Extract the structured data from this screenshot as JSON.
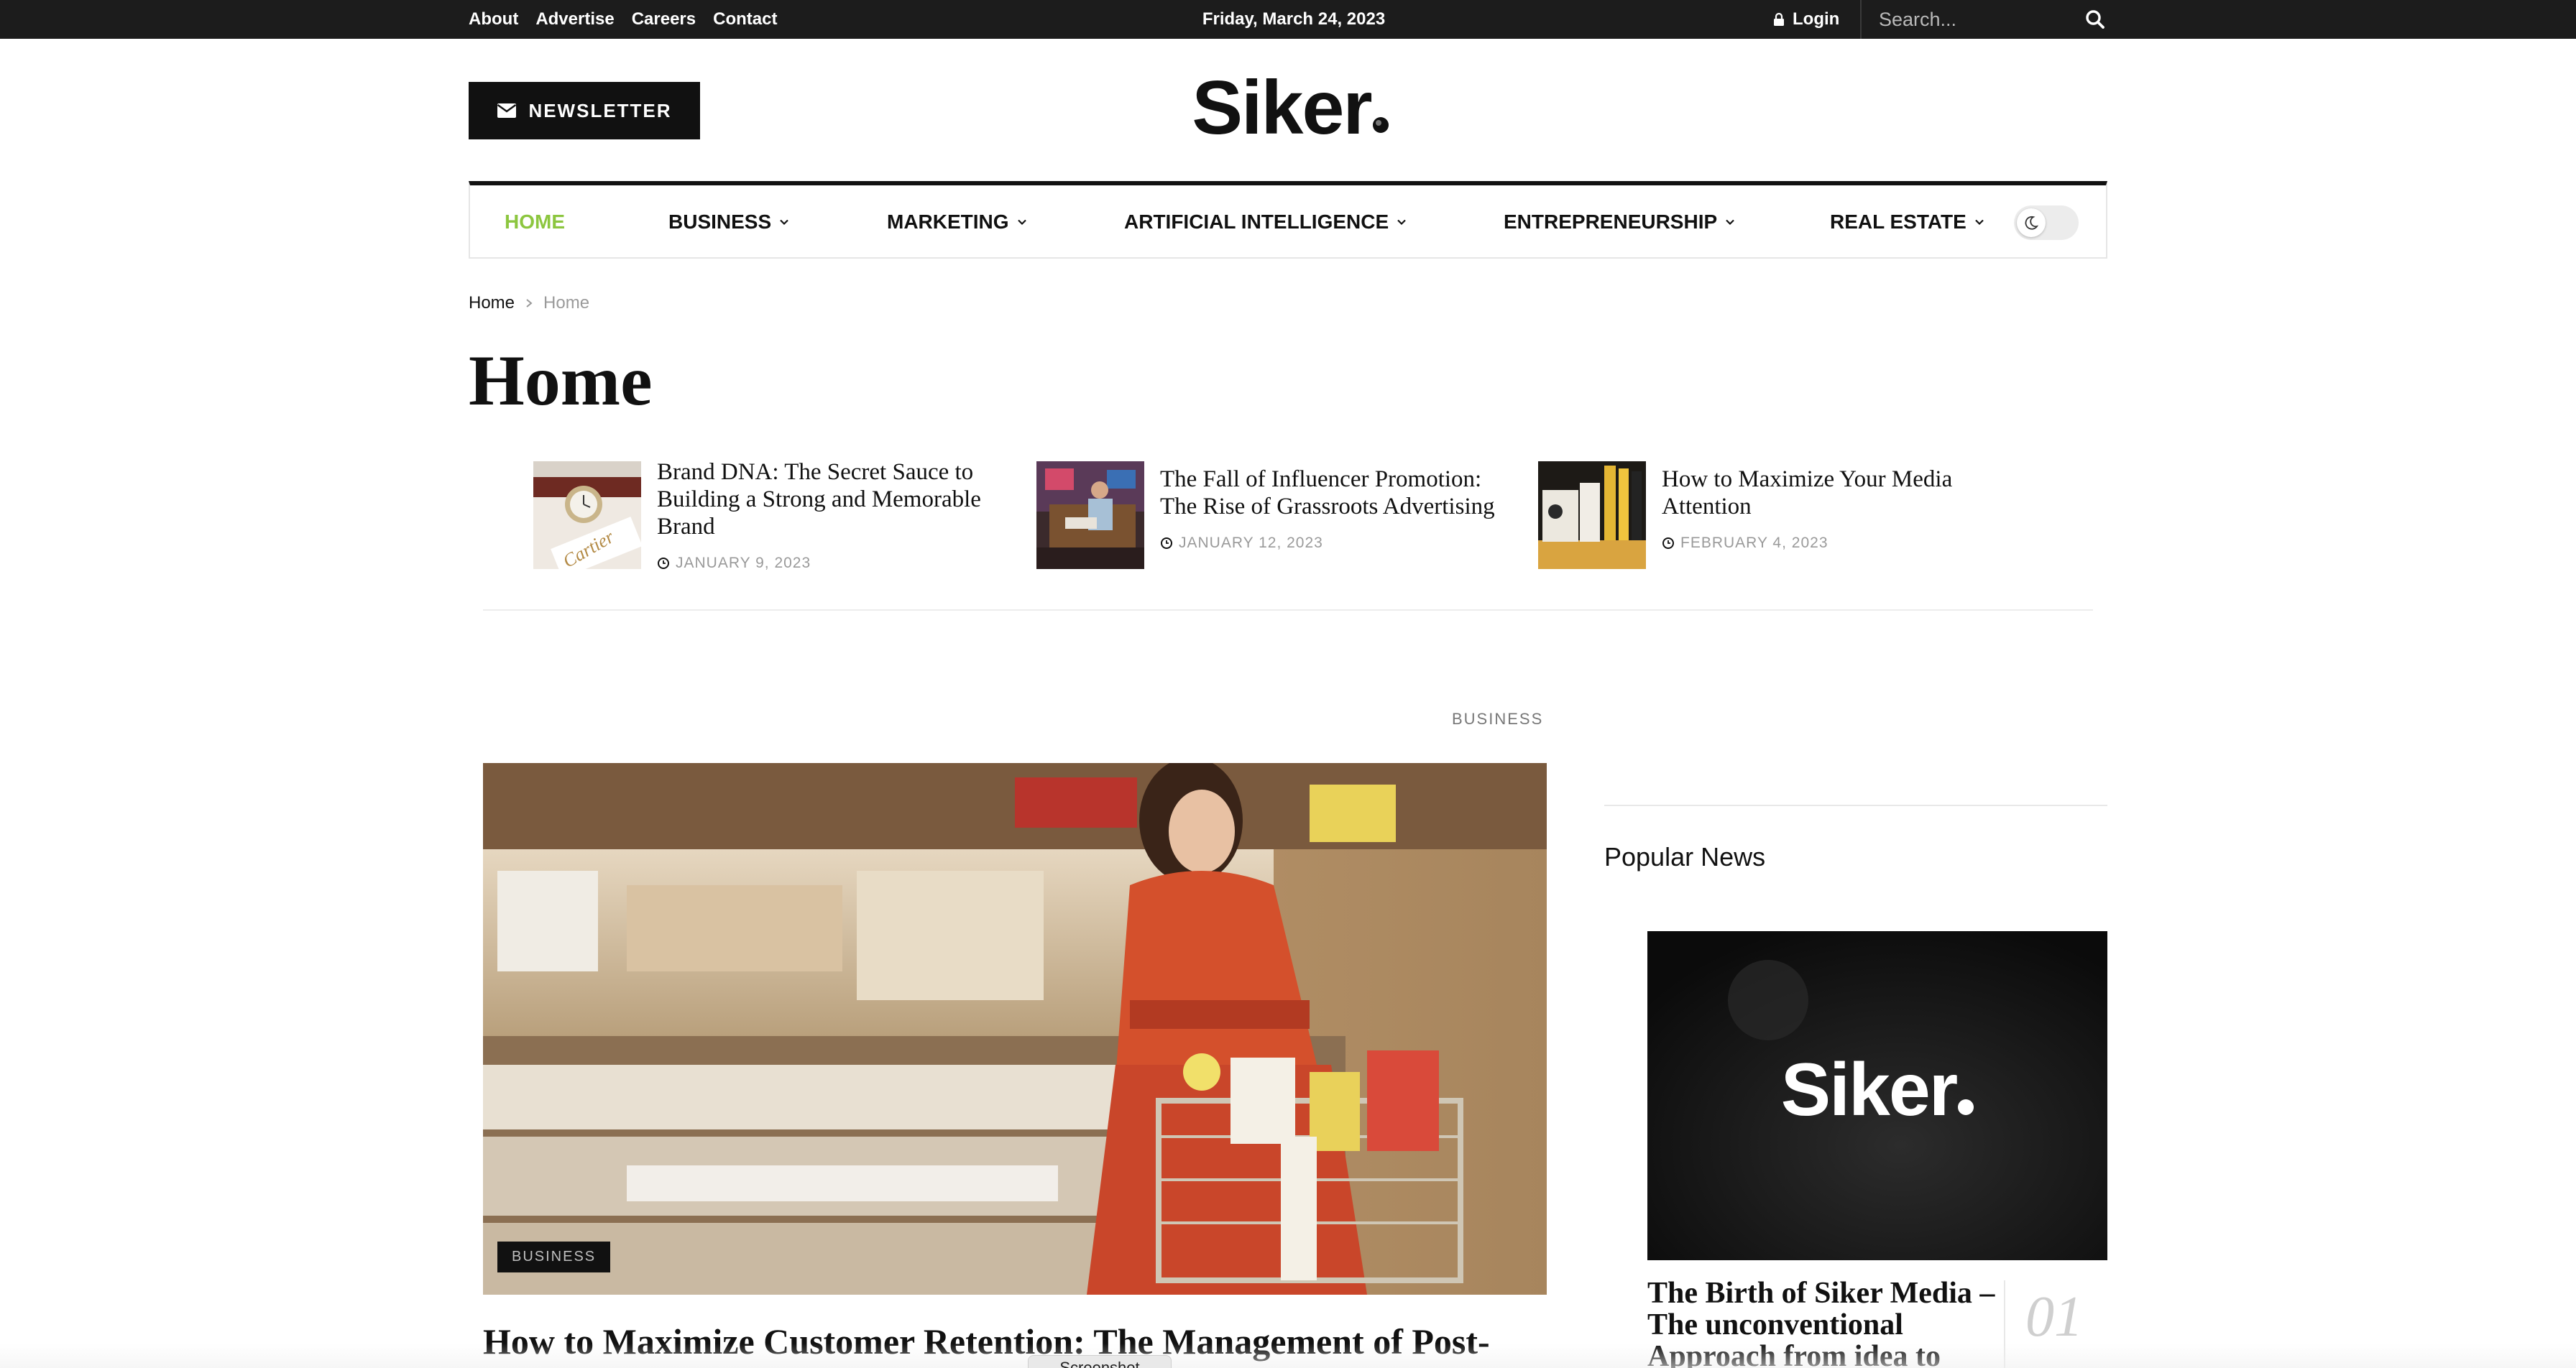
{
  "topbar": {
    "links": [
      "About",
      "Advertise",
      "Careers",
      "Contact"
    ],
    "date": "Friday, March 24, 2023",
    "login": "Login",
    "search_placeholder": "Search..."
  },
  "header": {
    "newsletter": "NEWSLETTER",
    "logo": "Siker"
  },
  "nav": {
    "items": [
      {
        "label": "HOME",
        "active": true
      },
      {
        "label": "BUSINESS"
      },
      {
        "label": "MARKETING"
      },
      {
        "label": "ARTIFICIAL INTELLIGENCE"
      },
      {
        "label": "ENTREPRENEURSHIP"
      },
      {
        "label": "REAL ESTATE"
      }
    ],
    "accent_color": "#8cc63f"
  },
  "breadcrumb": {
    "home": "Home",
    "current": "Home"
  },
  "page": {
    "title": "Home"
  },
  "trending": [
    {
      "title": "Brand DNA: The Secret Sauce to Building a Strong and Memorable Brand",
      "date": "JANUARY 9, 2023"
    },
    {
      "title": "The Fall of Influencer Promotion: The Rise of Grassroots Advertising",
      "date": "JANUARY 12, 2023"
    },
    {
      "title": "How to Maximize Your Media Attention",
      "date": "FEBRUARY 4, 2023"
    }
  ],
  "main": {
    "category": "BUSINESS",
    "badge": "BUSINESS",
    "title": "How to Maximize Customer Retention: The Management of Post-"
  },
  "sidebar": {
    "heading": "Popular News",
    "image_logo": "Siker",
    "title": "The Birth of Siker Media – The unconventional Approach from idea to",
    "number": "01"
  },
  "tooltip": "Screenshot"
}
